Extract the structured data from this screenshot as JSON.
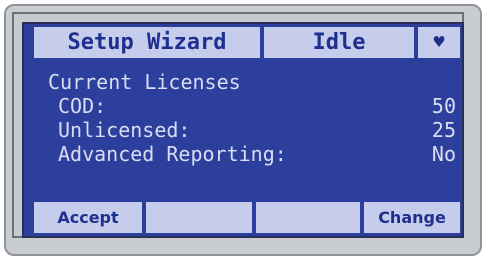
{
  "header": {
    "title": "Setup Wizard",
    "status": "Idle",
    "heart_icon": "♥"
  },
  "content": {
    "heading": "Current Licenses",
    "rows": [
      {
        "label": "COD:",
        "value": "50"
      },
      {
        "label": "Unlicensed:",
        "value": "25"
      },
      {
        "label": "Advanced Reporting:",
        "value": "No"
      }
    ]
  },
  "softkeys": {
    "accept_label": "Accept",
    "key2_label": "",
    "key3_label": "",
    "change_label": "Change"
  },
  "colors": {
    "lcd_background": "#2c3f9c",
    "lcd_text": "#d9ddf3",
    "bar_background": "#c5ccec",
    "bar_text": "#1f2f8e"
  }
}
